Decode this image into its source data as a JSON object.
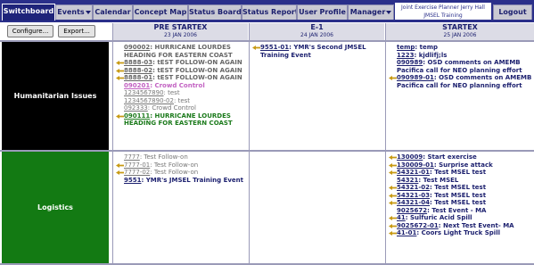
{
  "nav": {
    "tabs": [
      "Switchboard",
      "Events",
      "Calendar",
      "Concept Map",
      "Status Board",
      "Status Report",
      "User Profile",
      "Manager"
    ],
    "info_line1": "Joint Exercise Planner Jerry Hall",
    "info_line2": "JMSEL Training",
    "logout": "Logout"
  },
  "toolbar": {
    "configure": "Configure...",
    "export": "Export..."
  },
  "columns": [
    {
      "title": "PRE STARTEX",
      "date": "23 JAN 2006"
    },
    {
      "title": "E-1",
      "date": "24 JAN 2006"
    },
    {
      "title": "STARTEX",
      "date": "25 JAN 2006"
    }
  ],
  "rows": [
    {
      "label": "Humanitarian Issues",
      "cells": [
        [
          {
            "num": "090002",
            "text": ": HURRICANE LOURDES HEADING FOR EASTERN COAST",
            "style": "c-grayb",
            "arrow": false
          },
          {
            "num": "8888-03",
            "text": ": tEST FOLLOW-ON AGAIN",
            "style": "c-grayb",
            "arrow": true
          },
          {
            "num": "8888-02",
            "text": ": tEST FOLLOW-ON AGAIN",
            "style": "c-grayb",
            "arrow": true
          },
          {
            "num": "8888-01",
            "text": ": tEST FOLLOW-ON AGAIN",
            "style": "c-grayb",
            "arrow": true
          },
          {
            "num": "090201",
            "text": ": Crowd Control",
            "style": "c-pink",
            "arrow": false
          },
          {
            "num": "1234567890",
            "text": ": test",
            "style": "c-gray",
            "arrow": false
          },
          {
            "num": "1234567890-02",
            "text": ": test",
            "style": "c-gray",
            "arrow": false
          },
          {
            "num": "092333",
            "text": ": Crowd Control",
            "style": "c-gray",
            "arrow": false
          },
          {
            "num": "090111",
            "text": ": HURRICANE LOURDES HEADING FOR EASTERN COAST",
            "style": "c-green",
            "arrow": true
          }
        ],
        [
          {
            "num": "9551-01",
            "text": ": YMR's Second JMSEL Training Event",
            "style": "c-bold",
            "arrow": true
          }
        ],
        [
          {
            "num": "temp",
            "text": ": temp",
            "style": "c-bold",
            "arrow": false
          },
          {
            "num": "1223",
            "text": ": kjdlifj;ls",
            "style": "c-bold",
            "arrow": false
          },
          {
            "num": "090989",
            "text": ": OSD comments on AMEMB Pacifica call for NEO planning effort",
            "style": "c-bold",
            "arrow": false
          },
          {
            "num": "090989-01",
            "text": ": OSD comments on AMEMB Pacifica call for NEO planning effort",
            "style": "c-bold",
            "arrow": true
          }
        ]
      ]
    },
    {
      "label": "Logistics",
      "cells": [
        [
          {
            "num": "7777",
            "text": ": Test Follow-on",
            "style": "c-gray",
            "arrow": false
          },
          {
            "num": "7777-01",
            "text": ": Test Follow-on",
            "style": "c-gray",
            "arrow": true
          },
          {
            "num": "7777-02",
            "text": ": Test Follow-on",
            "style": "c-gray",
            "arrow": true
          },
          {
            "num": "9551",
            "text": ": YMR's JMSEL Training Event",
            "style": "c-bold",
            "arrow": false
          }
        ],
        [],
        [
          {
            "num": "130009",
            "text": ": Start exercise",
            "style": "c-bold",
            "arrow": true
          },
          {
            "num": "130009-01",
            "text": ": Surprise attack",
            "style": "c-bold",
            "arrow": true
          },
          {
            "num": "54321-01",
            "text": ": Test MSEL test",
            "style": "c-bold",
            "arrow": true
          },
          {
            "num": "54321",
            "text": ": Test MSEL",
            "style": "c-bold",
            "arrow": false
          },
          {
            "num": "54321-02",
            "text": ": Test MSEL test",
            "style": "c-bold",
            "arrow": true
          },
          {
            "num": "54321-03",
            "text": ": Test MSEL test",
            "style": "c-bold",
            "arrow": true
          },
          {
            "num": "54321-04",
            "text": ": Test MSEL test",
            "style": "c-bold",
            "arrow": true
          },
          {
            "num": "9025672",
            "text": ": Test Event - MA",
            "style": "c-bold",
            "arrow": false
          },
          {
            "num": "41",
            "text": ": Sulfuric Acid Spill",
            "style": "c-bold",
            "arrow": true
          },
          {
            "num": "9025672-01",
            "text": ": Next Test Event- MA",
            "style": "c-bold",
            "arrow": true
          },
          {
            "num": "41-01",
            "text": ": Coors Light Truck Spill",
            "style": "c-bold",
            "arrow": true
          }
        ]
      ]
    }
  ],
  "colors": {
    "nav_bg": "#2a2f8a",
    "humanitarian_bg": "#000000",
    "logistics_bg": "#137a13",
    "arrow": "#c89a14"
  }
}
